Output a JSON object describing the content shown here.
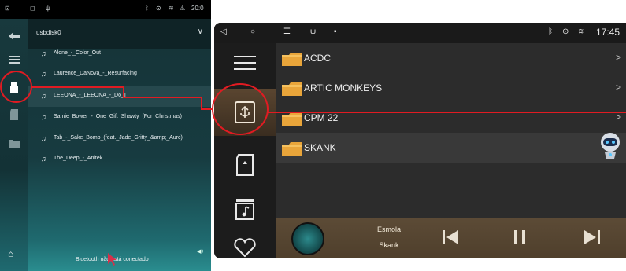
{
  "left_screen": {
    "status": {
      "time": "20:0"
    },
    "rail_icons": [
      "back-arrow-icon",
      "menu-icon",
      "usb-storage-icon",
      "sd-card-icon",
      "folder-icon"
    ],
    "device": "usbdisk0",
    "tracks": [
      "Alone_-_Color_Out",
      "Laurence_DaNova_-_Resurfacing",
      "LEEONA_-_LEEONA_-_Do_I",
      "Samie_Bower_-_One_Gift_Shawty_(For_Christmas)",
      "Tab_-_Sake_Bomb_(feat._Jade_Gritty_&amp;_Aurc)",
      "The_Deep_-_Anitek"
    ],
    "selected_track_index": 2,
    "bluetooth_status": "Bluetooth não está conectado"
  },
  "right_screen": {
    "status": {
      "time": "17:45"
    },
    "rail_icons": [
      "list-icon",
      "usb-icon",
      "sd-card-icon",
      "music-folder-icon",
      "heart-icon"
    ],
    "folders": [
      {
        "name": "ACDC",
        "arrow": ">"
      },
      {
        "name": "ARTIC MONKEYS",
        "arrow": ">"
      },
      {
        "name": "CPM 22",
        "arrow": ">"
      },
      {
        "name": "SKANK",
        "arrow": ""
      }
    ],
    "player": {
      "song": "Esmola",
      "artist": "Skank"
    }
  },
  "colors": {
    "highlight": "#e11b22",
    "folder": "#e9a53a",
    "left_bg": "#0c2a2e",
    "player_bg": "#5c4b36"
  }
}
